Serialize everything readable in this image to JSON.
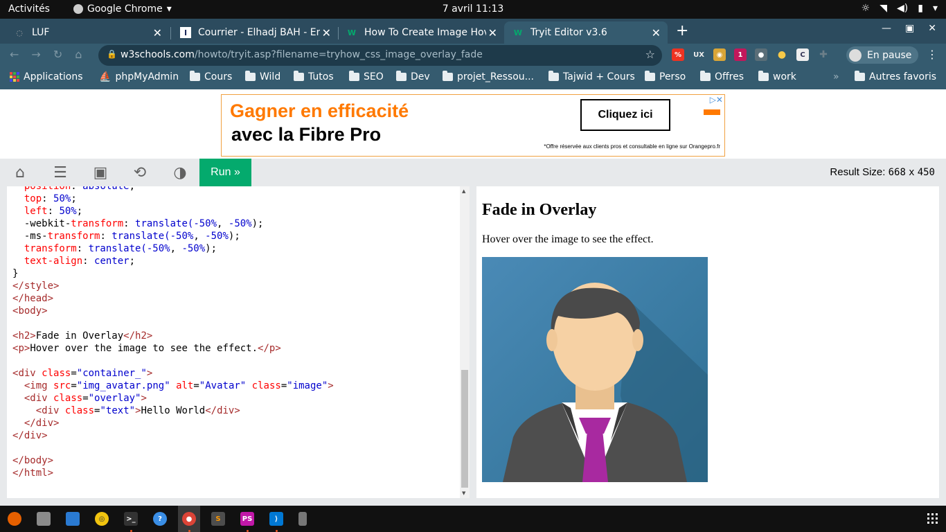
{
  "system": {
    "activities": "Activités",
    "app_name": "Google Chrome",
    "clock": "7 avril  11:13"
  },
  "tabs": [
    {
      "title": "LUF"
    },
    {
      "title": "Courrier - Elhadj BAH - Em"
    },
    {
      "title": "How To Create Image Hov"
    },
    {
      "title": "Tryit Editor v3.6"
    }
  ],
  "address": {
    "domain": "w3schools.com",
    "path": "/howto/tryit.asp?filename=tryhow_css_image_overlay_fade"
  },
  "profile": {
    "label": "En pause"
  },
  "bookmarks": [
    {
      "label": "Applications"
    },
    {
      "label": "phpMyAdmin"
    },
    {
      "label": "Cours"
    },
    {
      "label": "Wild"
    },
    {
      "label": "Tutos"
    },
    {
      "label": "SEO"
    },
    {
      "label": "Dev"
    },
    {
      "label": "projet_Ressou..."
    },
    {
      "label": "Tajwid + Cours"
    },
    {
      "label": "Perso"
    },
    {
      "label": "Offres"
    },
    {
      "label": "work"
    },
    {
      "label": "Autres favoris"
    }
  ],
  "ad": {
    "headline": "Gagner en efficacité",
    "subline": "avec la Fibre Pro",
    "button": "Cliquez ici",
    "note": "*Offre réservée aux clients pros et consultable en ligne sur Orangepro.fr"
  },
  "tryit": {
    "run_label": "Run »",
    "result_size_label": "Result Size:",
    "width": "668",
    "x": "x",
    "height": "450"
  },
  "result": {
    "heading": "Fade in Overlay",
    "text": "Hover over the image to see the effect."
  },
  "code_lines": [
    {
      "parts": [
        {
          "t": "  ",
          "c": ""
        },
        {
          "t": "position",
          "c": "pr"
        },
        {
          "t": ": ",
          "c": ""
        },
        {
          "t": "absolute",
          "c": "vl"
        },
        {
          "t": ";",
          "c": ""
        }
      ]
    },
    {
      "parts": [
        {
          "t": "  ",
          "c": ""
        },
        {
          "t": "top",
          "c": "pr"
        },
        {
          "t": ": ",
          "c": ""
        },
        {
          "t": "50%",
          "c": "vl"
        },
        {
          "t": ";",
          "c": ""
        }
      ]
    },
    {
      "parts": [
        {
          "t": "  ",
          "c": ""
        },
        {
          "t": "left",
          "c": "pr"
        },
        {
          "t": ": ",
          "c": ""
        },
        {
          "t": "50%",
          "c": "vl"
        },
        {
          "t": ";",
          "c": ""
        }
      ]
    },
    {
      "parts": [
        {
          "t": "  -webkit-",
          "c": ""
        },
        {
          "t": "transform",
          "c": "pr"
        },
        {
          "t": ": ",
          "c": ""
        },
        {
          "t": "translate(",
          "c": "vl"
        },
        {
          "t": "-50%",
          "c": "vl"
        },
        {
          "t": ", ",
          "c": ""
        },
        {
          "t": "-50%",
          "c": "vl"
        },
        {
          "t": ");",
          "c": ""
        }
      ]
    },
    {
      "parts": [
        {
          "t": "  -ms-",
          "c": ""
        },
        {
          "t": "transform",
          "c": "pr"
        },
        {
          "t": ": ",
          "c": ""
        },
        {
          "t": "translate(",
          "c": "vl"
        },
        {
          "t": "-50%",
          "c": "vl"
        },
        {
          "t": ", ",
          "c": ""
        },
        {
          "t": "-50%",
          "c": "vl"
        },
        {
          "t": ");",
          "c": ""
        }
      ]
    },
    {
      "parts": [
        {
          "t": "  ",
          "c": ""
        },
        {
          "t": "transform",
          "c": "pr"
        },
        {
          "t": ": ",
          "c": ""
        },
        {
          "t": "translate(",
          "c": "vl"
        },
        {
          "t": "-50%",
          "c": "vl"
        },
        {
          "t": ", ",
          "c": ""
        },
        {
          "t": "-50%",
          "c": "vl"
        },
        {
          "t": ");",
          "c": ""
        }
      ]
    },
    {
      "parts": [
        {
          "t": "  ",
          "c": ""
        },
        {
          "t": "text-align",
          "c": "pr"
        },
        {
          "t": ": ",
          "c": ""
        },
        {
          "t": "center",
          "c": "vl"
        },
        {
          "t": ";",
          "c": ""
        }
      ]
    },
    {
      "parts": [
        {
          "t": "}",
          "c": ""
        }
      ]
    },
    {
      "parts": [
        {
          "t": "</",
          "c": "br"
        },
        {
          "t": "style",
          "c": "tg"
        },
        {
          "t": ">",
          "c": "br"
        }
      ]
    },
    {
      "parts": [
        {
          "t": "</",
          "c": "br"
        },
        {
          "t": "head",
          "c": "tg"
        },
        {
          "t": ">",
          "c": "br"
        }
      ]
    },
    {
      "parts": [
        {
          "t": "<",
          "c": "br"
        },
        {
          "t": "body",
          "c": "tg"
        },
        {
          "t": ">",
          "c": "br"
        }
      ]
    },
    {
      "parts": [
        {
          "t": "",
          "c": ""
        }
      ]
    },
    {
      "parts": [
        {
          "t": "<",
          "c": "br"
        },
        {
          "t": "h2",
          "c": "tg"
        },
        {
          "t": ">",
          "c": "br"
        },
        {
          "t": "Fade in Overlay",
          "c": ""
        },
        {
          "t": "</",
          "c": "br"
        },
        {
          "t": "h2",
          "c": "tg"
        },
        {
          "t": ">",
          "c": "br"
        }
      ]
    },
    {
      "parts": [
        {
          "t": "<",
          "c": "br"
        },
        {
          "t": "p",
          "c": "tg"
        },
        {
          "t": ">",
          "c": "br"
        },
        {
          "t": "Hover over the image to see the effect.",
          "c": ""
        },
        {
          "t": "</",
          "c": "br"
        },
        {
          "t": "p",
          "c": "tg"
        },
        {
          "t": ">",
          "c": "br"
        }
      ]
    },
    {
      "parts": [
        {
          "t": "",
          "c": ""
        }
      ]
    },
    {
      "parts": [
        {
          "t": "<",
          "c": "br"
        },
        {
          "t": "div",
          "c": "tg"
        },
        {
          "t": " ",
          "c": ""
        },
        {
          "t": "class",
          "c": "at"
        },
        {
          "t": "=",
          "c": ""
        },
        {
          "t": "\"container_\"",
          "c": "av"
        },
        {
          "t": ">",
          "c": "br"
        }
      ]
    },
    {
      "parts": [
        {
          "t": "  <",
          "c": "br"
        },
        {
          "t": "img",
          "c": "tg"
        },
        {
          "t": " ",
          "c": ""
        },
        {
          "t": "src",
          "c": "at"
        },
        {
          "t": "=",
          "c": ""
        },
        {
          "t": "\"img_avatar.png\"",
          "c": "av"
        },
        {
          "t": " ",
          "c": ""
        },
        {
          "t": "alt",
          "c": "at"
        },
        {
          "t": "=",
          "c": ""
        },
        {
          "t": "\"Avatar\"",
          "c": "av"
        },
        {
          "t": " ",
          "c": ""
        },
        {
          "t": "class",
          "c": "at"
        },
        {
          "t": "=",
          "c": ""
        },
        {
          "t": "\"image\"",
          "c": "av"
        },
        {
          "t": ">",
          "c": "br"
        }
      ]
    },
    {
      "parts": [
        {
          "t": "  <",
          "c": "br"
        },
        {
          "t": "div",
          "c": "tg"
        },
        {
          "t": " ",
          "c": ""
        },
        {
          "t": "class",
          "c": "at"
        },
        {
          "t": "=",
          "c": ""
        },
        {
          "t": "\"overlay\"",
          "c": "av"
        },
        {
          "t": ">",
          "c": "br"
        }
      ]
    },
    {
      "parts": [
        {
          "t": "    <",
          "c": "br"
        },
        {
          "t": "div",
          "c": "tg"
        },
        {
          "t": " ",
          "c": ""
        },
        {
          "t": "class",
          "c": "at"
        },
        {
          "t": "=",
          "c": ""
        },
        {
          "t": "\"text\"",
          "c": "av"
        },
        {
          "t": ">",
          "c": "br"
        },
        {
          "t": "Hello World",
          "c": ""
        },
        {
          "t": "</",
          "c": "br"
        },
        {
          "t": "div",
          "c": "tg"
        },
        {
          "t": ">",
          "c": "br"
        }
      ]
    },
    {
      "parts": [
        {
          "t": "  </",
          "c": "br"
        },
        {
          "t": "div",
          "c": "tg"
        },
        {
          "t": ">",
          "c": "br"
        }
      ]
    },
    {
      "parts": [
        {
          "t": "</",
          "c": "br"
        },
        {
          "t": "div",
          "c": "tg"
        },
        {
          "t": ">",
          "c": "br"
        }
      ]
    },
    {
      "parts": [
        {
          "t": "",
          "c": ""
        }
      ]
    },
    {
      "parts": [
        {
          "t": "</",
          "c": "br"
        },
        {
          "t": "body",
          "c": "tg"
        },
        {
          "t": ">",
          "c": "br"
        }
      ]
    },
    {
      "parts": [
        {
          "t": "</",
          "c": "br"
        },
        {
          "t": "html",
          "c": "tg"
        },
        {
          "t": ">",
          "c": "br"
        }
      ]
    }
  ],
  "colors": {
    "run_green": "#04aa6d",
    "tab_bg": "#2c4b5e",
    "toolbar_bg": "#355b6f",
    "ad_orange": "#ff7900"
  },
  "icons": [
    "home-icon",
    "menu-icon",
    "save-icon",
    "rotate-icon",
    "contrast-icon",
    "star-icon",
    "lock-icon",
    "firefox-icon",
    "files-icon",
    "writer-icon",
    "rhythmbox-icon",
    "terminal-icon",
    "help-icon",
    "chrome-icon",
    "sublime-icon",
    "phpstorm-icon",
    "vscode-icon",
    "usb-icon",
    "apps-grid-icon"
  ]
}
